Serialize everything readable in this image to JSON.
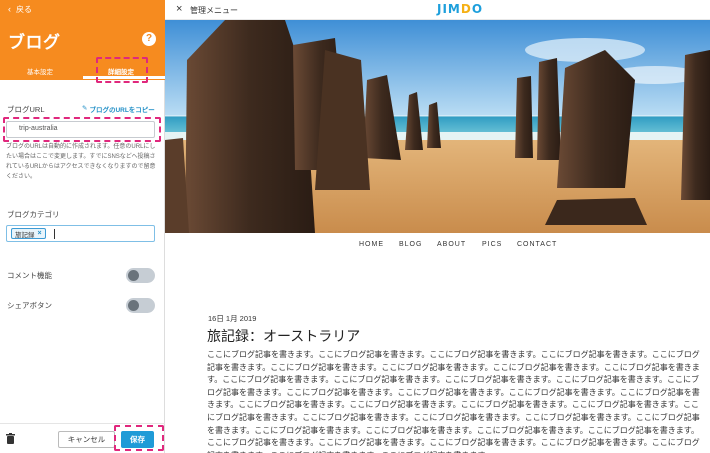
{
  "panel": {
    "back_label": "戻る",
    "title": "ブログ",
    "help_label": "?",
    "tabs": [
      {
        "label": "基本設定",
        "active": false
      },
      {
        "label": "詳細設定",
        "active": true
      }
    ],
    "blog_url": {
      "label": "ブログURL",
      "copy_label": "ブログのURLをコピー",
      "value": "trip-australia",
      "help_text": "ブログのURLは自動的に作成されます。任意のURLにしたい場合はここで変更します。すでにSNSなどへ投稿されているURLからはアクセスできなくなりますので留意ください。"
    },
    "category": {
      "label": "ブログカテゴリ",
      "tags": [
        "旅記録"
      ]
    },
    "toggles": [
      {
        "label": "コメント機能",
        "on": false
      },
      {
        "label": "シェアボタン",
        "on": false
      }
    ],
    "footer": {
      "cancel_label": "キャンセル",
      "save_label": "保存"
    },
    "colors": {
      "header": "#f68b1f",
      "accent": "#1f9bd7",
      "highlight": "#e0287d"
    }
  },
  "topbar": {
    "admin_menu_label": "管理メニュー",
    "logo_text": "JIMDO"
  },
  "site": {
    "nav": [
      "HOME",
      "BLOG",
      "ABOUT",
      "PICS",
      "CONTACT"
    ],
    "post": {
      "date": "16日 1月 2019",
      "title": "旅記録：オーストラリア",
      "body": "ここにブログ記事を書きます。ここにブログ記事を書きます。ここにブログ記事を書きます。ここにブログ記事を書きます。ここにブログ記事を書きます。ここにブログ記事を書きます。ここにブログ記事を書きます。ここにブログ記事を書きます。ここにブログ記事を書きます。ここにブログ記事を書きます。ここにブログ記事を書きます。ここにブログ記事を書きます。ここにブログ記事を書きます。ここにブログ記事を書きます。ここにブログ記事を書きます。ここにブログ記事を書きます。ここにブログ記事を書きます。ここにブログ記事を書きます。ここにブログ記事を書きます。ここにブログ記事を書きます。ここにブログ記事を書きます。ここにブログ記事を書きます。ここにブログ記事を書きます。ここにブログ記事を書きます。ここにブログ記事を書きます。ここにブログ記事を書きます。ここにブログ記事を書きます。ここにブログ記事を書きます。ここにブログ記事を書きます。ここにブログ記事を書きます。ここにブログ記事を書きます。ここにブログ記事を書きます。ここにブログ記事を書きます。ここにブログ記事を書きます。ここにブログ記事を書きます。ここにブログ記事を書きます。ここにブログ記事を書きます。ここにブログ記事を書きます。"
    }
  }
}
